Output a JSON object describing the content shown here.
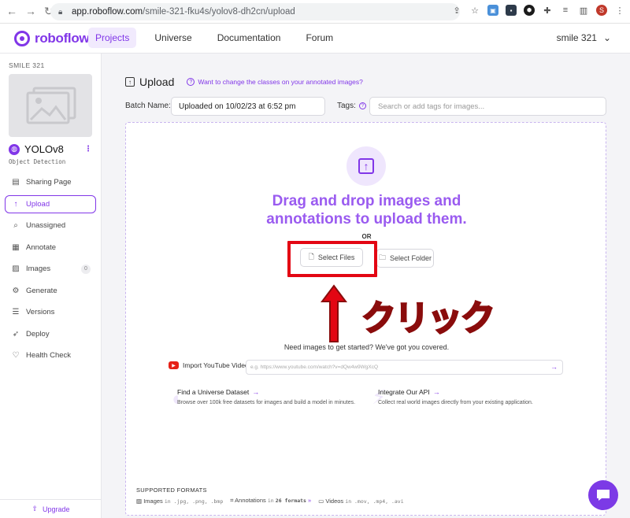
{
  "browser": {
    "url_host": "app.roboflow.com",
    "url_path": "/smile-321-fku4s/yolov8-dh2cn/upload",
    "profile_initial": "S"
  },
  "topnav": {
    "logo_text": "roboflow",
    "items": [
      {
        "label": "Projects",
        "active": true
      },
      {
        "label": "Universe",
        "active": false
      },
      {
        "label": "Documentation",
        "active": false
      },
      {
        "label": "Forum",
        "active": false
      }
    ],
    "user": "smile 321"
  },
  "sidebar": {
    "workspace": "SMILE 321",
    "project_name": "YOLOv8",
    "project_type": "Object Detection",
    "items": [
      {
        "label": "Sharing Page",
        "icon": "document-icon",
        "active": false
      },
      {
        "label": "Upload",
        "icon": "upload-arrow-icon",
        "active": true
      },
      {
        "label": "Unassigned",
        "icon": "search-icon",
        "active": false
      },
      {
        "label": "Annotate",
        "icon": "grid-icon",
        "active": false
      },
      {
        "label": "Images",
        "icon": "images-icon",
        "active": false,
        "count": "0"
      },
      {
        "label": "Generate",
        "icon": "sliders-icon",
        "active": false
      },
      {
        "label": "Versions",
        "icon": "layers-icon",
        "active": false
      },
      {
        "label": "Deploy",
        "icon": "rocket-icon",
        "active": false
      },
      {
        "label": "Health Check",
        "icon": "health-icon",
        "active": false
      }
    ],
    "upgrade": "Upgrade"
  },
  "upload": {
    "title": "Upload",
    "help_link": "Want to change the classes on your annotated images?",
    "batch_label": "Batch Name:",
    "batch_value": "Uploaded on 10/02/23 at 6:52 pm",
    "tags_label": "Tags:",
    "tags_placeholder": "Search or add tags for images..."
  },
  "dropzone": {
    "title_line1": "Drag and drop images and",
    "title_line2": "annotations to upload them.",
    "or": "OR",
    "select_files": "Select Files",
    "select_folder": "Select Folder",
    "annotation_text": "クリック",
    "need_images": "Need images to get started? We've got you covered.",
    "youtube_label": "Import YouTube Video:",
    "youtube_placeholder": "e.g. https://www.youtube.com/watch?v=dQw4w9WgXcQ",
    "universe_title": "Find a Universe Dataset",
    "universe_desc": "Browse over 100k free datasets for images and build a model in minutes.",
    "api_title": "Integrate Our API",
    "api_desc": "Collect real world images directly from your existing application."
  },
  "formats": {
    "title": "SUPPORTED FORMATS",
    "images_label": "Images",
    "images_ext": "in .jpg, .png, .bmp",
    "annotations_label": "Annotations",
    "annotations_in": "in",
    "annotations_count": "26 formats",
    "videos_label": "Videos",
    "videos_ext": "in .mov, .mp4, .avi"
  },
  "colors": {
    "accent": "#8136e8",
    "highlight_red": "#e30613"
  }
}
